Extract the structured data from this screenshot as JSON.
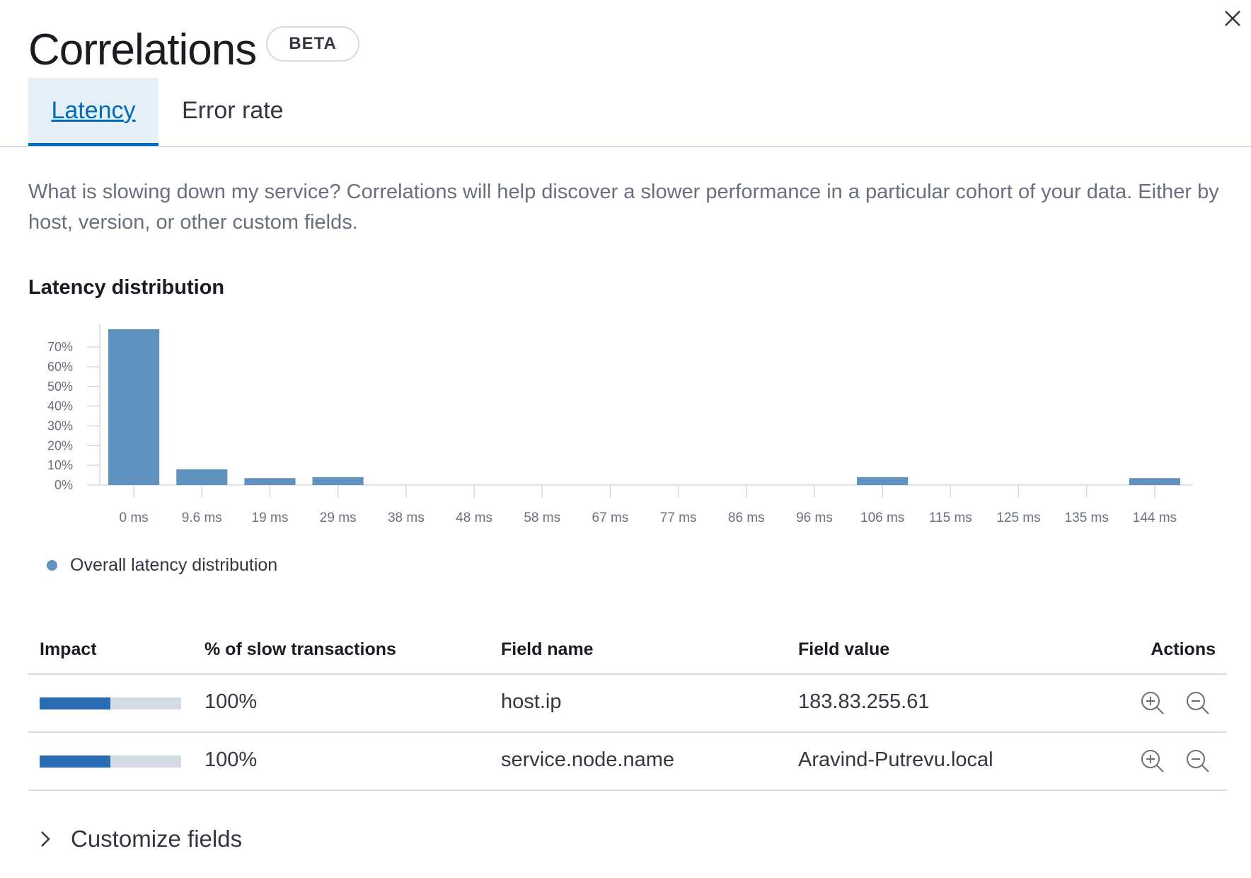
{
  "header": {
    "title": "Correlations",
    "badge": "BETA",
    "close_icon": "close-icon"
  },
  "tabs": [
    {
      "label": "Latency",
      "active": true
    },
    {
      "label": "Error rate",
      "active": false
    }
  ],
  "description": "What is slowing down my service? Correlations will help discover a slower performance in a particular cohort of your data. Either by host, version, or other custom fields.",
  "section_title": "Latency distribution",
  "chart_data": {
    "type": "bar",
    "title": "Latency distribution",
    "categories": [
      "0 ms",
      "9.6 ms",
      "19 ms",
      "29 ms",
      "38 ms",
      "48 ms",
      "58 ms",
      "67 ms",
      "77 ms",
      "86 ms",
      "96 ms",
      "106 ms",
      "115 ms",
      "125 ms",
      "135 ms",
      "144 ms"
    ],
    "series": [
      {
        "name": "Overall latency distribution",
        "values": [
          79,
          8,
          3.5,
          4,
          0,
          0,
          0,
          0,
          0,
          0,
          0,
          4,
          0,
          0,
          0,
          3.5
        ]
      }
    ],
    "y_ticks": [
      "0%",
      "10%",
      "20%",
      "30%",
      "40%",
      "50%",
      "60%",
      "70%"
    ],
    "ylim": [
      0,
      79
    ],
    "xlabel": "",
    "ylabel": "",
    "color": "#6092c0"
  },
  "legend": {
    "label": "Overall latency distribution",
    "color": "#6092c0"
  },
  "table": {
    "headers": {
      "impact": "Impact",
      "slow": "% of slow transactions",
      "field_name": "Field name",
      "field_value": "Field value",
      "actions": "Actions"
    },
    "rows": [
      {
        "impact": 0.5,
        "slow": "100%",
        "field_name": "host.ip",
        "field_value": "183.83.255.61"
      },
      {
        "impact": 0.5,
        "slow": "100%",
        "field_name": "service.node.name",
        "field_value": "Aravind-Putrevu.local"
      }
    ],
    "action_icons": [
      "zoom-in-icon",
      "zoom-out-icon"
    ]
  },
  "customize": {
    "label": "Customize fields",
    "icon": "chevron-right-icon"
  },
  "colors": {
    "accent": "#006bb8",
    "bar": "#6092c0",
    "impact": "#2a6db5",
    "border": "#d3dae6"
  }
}
